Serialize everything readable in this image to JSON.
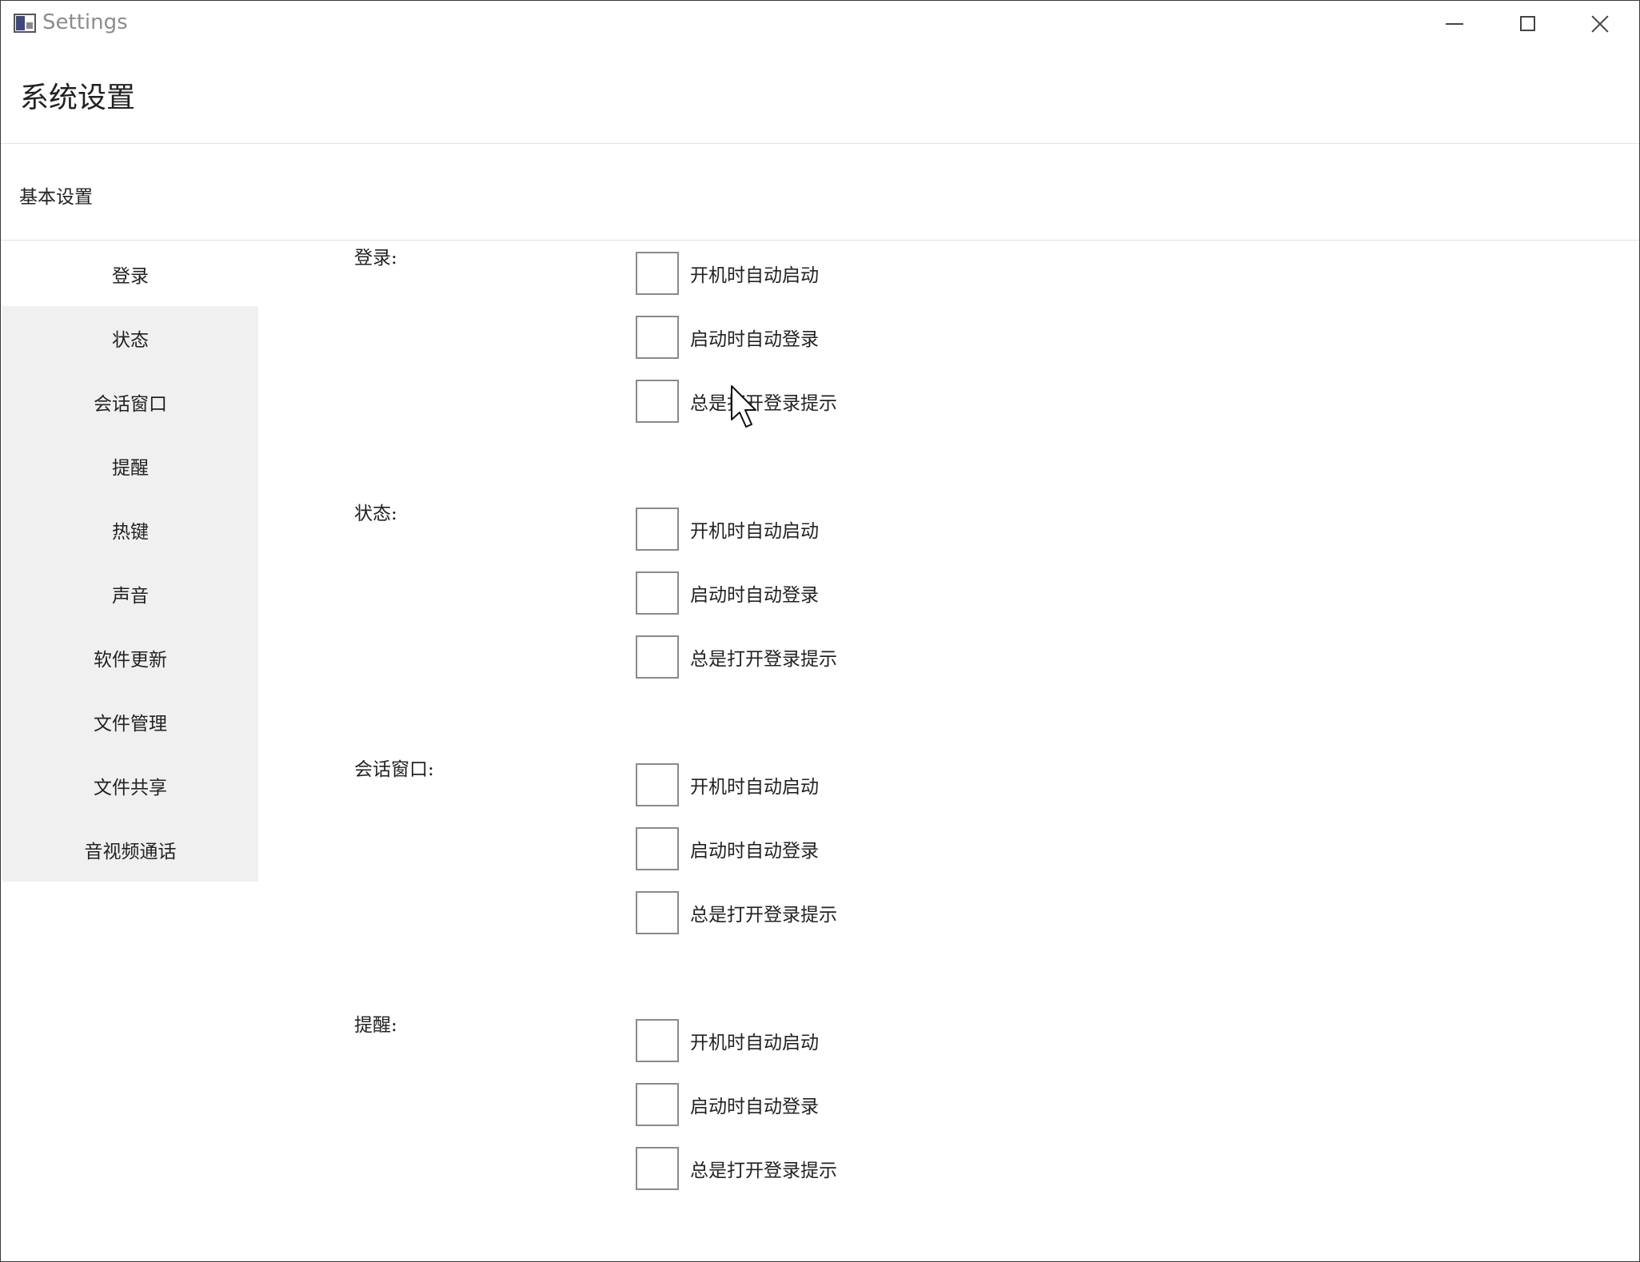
{
  "window": {
    "title": "Settings",
    "controls": {
      "minimize": "minimize",
      "maximize": "maximize",
      "close": "close"
    }
  },
  "header": {
    "title": "系统设置"
  },
  "section": {
    "label": "基本设置"
  },
  "sidebar": {
    "active_index": 0,
    "items": [
      {
        "label": "登录"
      },
      {
        "label": "状态"
      },
      {
        "label": "会话窗口"
      },
      {
        "label": "提醒"
      },
      {
        "label": "热键"
      },
      {
        "label": "声音"
      },
      {
        "label": "软件更新"
      },
      {
        "label": "文件管理"
      },
      {
        "label": "文件共享"
      },
      {
        "label": "音视频通话"
      }
    ]
  },
  "groups": [
    {
      "label": "登录:",
      "options": [
        {
          "label": "开机时自动启动",
          "checked": false
        },
        {
          "label": "启动时自动登录",
          "checked": false
        },
        {
          "label": "总是打开登录提示",
          "checked": false
        }
      ]
    },
    {
      "label": "状态:",
      "options": [
        {
          "label": "开机时自动启动",
          "checked": false
        },
        {
          "label": "启动时自动登录",
          "checked": false
        },
        {
          "label": "总是打开登录提示",
          "checked": false
        }
      ]
    },
    {
      "label": "会话窗口:",
      "options": [
        {
          "label": "开机时自动启动",
          "checked": false
        },
        {
          "label": "启动时自动登录",
          "checked": false
        },
        {
          "label": "总是打开登录提示",
          "checked": false
        }
      ]
    },
    {
      "label": "提醒:",
      "options": [
        {
          "label": "开机时自动启动",
          "checked": false
        },
        {
          "label": "启动时自动登录",
          "checked": false
        },
        {
          "label": "总是打开登录提示",
          "checked": false
        }
      ]
    }
  ]
}
